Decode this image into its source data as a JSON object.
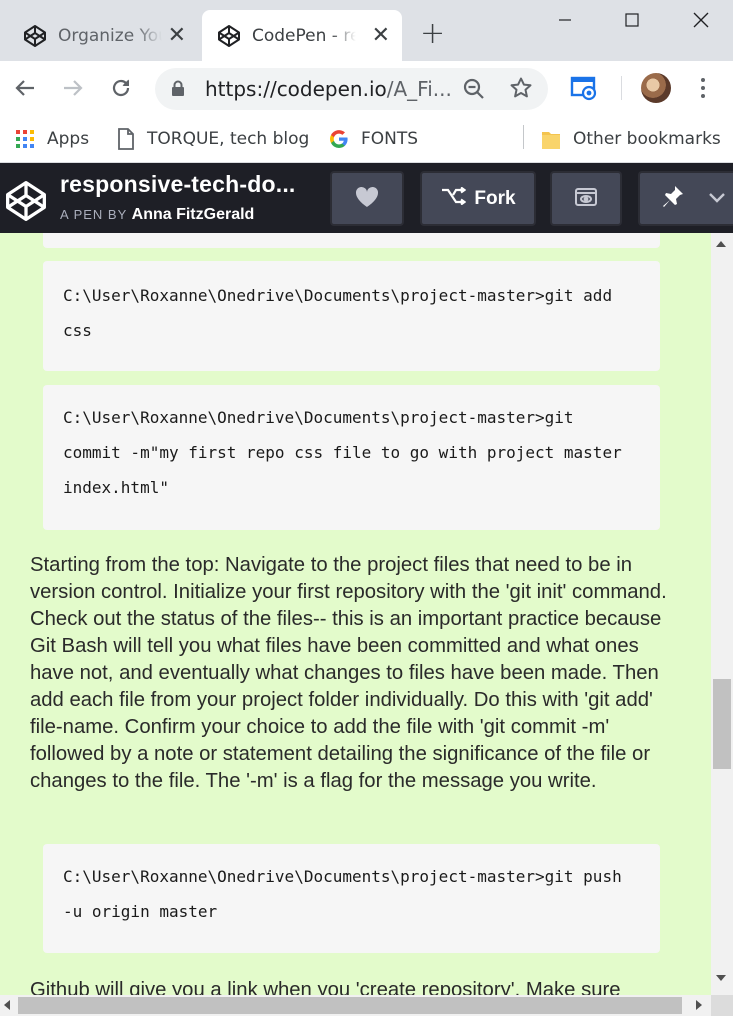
{
  "browser": {
    "tabs": [
      {
        "title": "Organize Your",
        "favicon": "codepen-icon",
        "close": "✕",
        "active": false
      },
      {
        "title": "CodePen - re",
        "favicon": "codepen-icon",
        "close": "✕",
        "active": true
      }
    ],
    "new_tab": "+",
    "url_host": "https://codepen.io",
    "url_rest": "/A_Fi...",
    "bookmarks": [
      {
        "label": "Apps",
        "icon": "apps-grid-icon"
      },
      {
        "label": "TORQUE, tech blog",
        "icon": "page-icon"
      },
      {
        "label": "FONTS",
        "icon": "google-g-icon"
      },
      {
        "label": "Other bookmarks",
        "icon": "folder-icon"
      }
    ]
  },
  "codepen": {
    "title": "responsive-tech-do...",
    "byline_prefix": "A PEN BY",
    "author": "Anna FitzGerald",
    "fork_label": "Fork"
  },
  "content": {
    "code_add": "C:\\User\\Roxanne\\Onedrive\\Documents\\project-master>git add css",
    "code_commit": "C:\\User\\Roxanne\\Onedrive\\Documents\\project-master>git commit -m\"my first repo css file to go with project master index.html\"",
    "paragraph": "Starting from the top: Navigate to the project files that need to be in version control. Initialize your first repository with the 'git init' command. Check out the status of the files-- this is an important practice because Git Bash will tell you what files have been committed and what ones have not, and eventually what changes to files have been made. Then add each file from your project folder individually. Do this with 'git add' file-name. Confirm your choice to add the file with 'git commit -m' followed by a note or statement detailing the significance of the file or changes to the file. The '-m' is a flag for the message you write.",
    "code_push": "C:\\User\\Roxanne\\Onedrive\\Documents\\project-master>git push -u origin master",
    "paragraph_next": "Github will give you a link when you 'create repository'. Make sure"
  },
  "colors": {
    "page_background": "#e3fbcb",
    "code_background": "#f6f6f6",
    "codepen_header": "#1e1f26",
    "codepen_button": "#444857"
  }
}
